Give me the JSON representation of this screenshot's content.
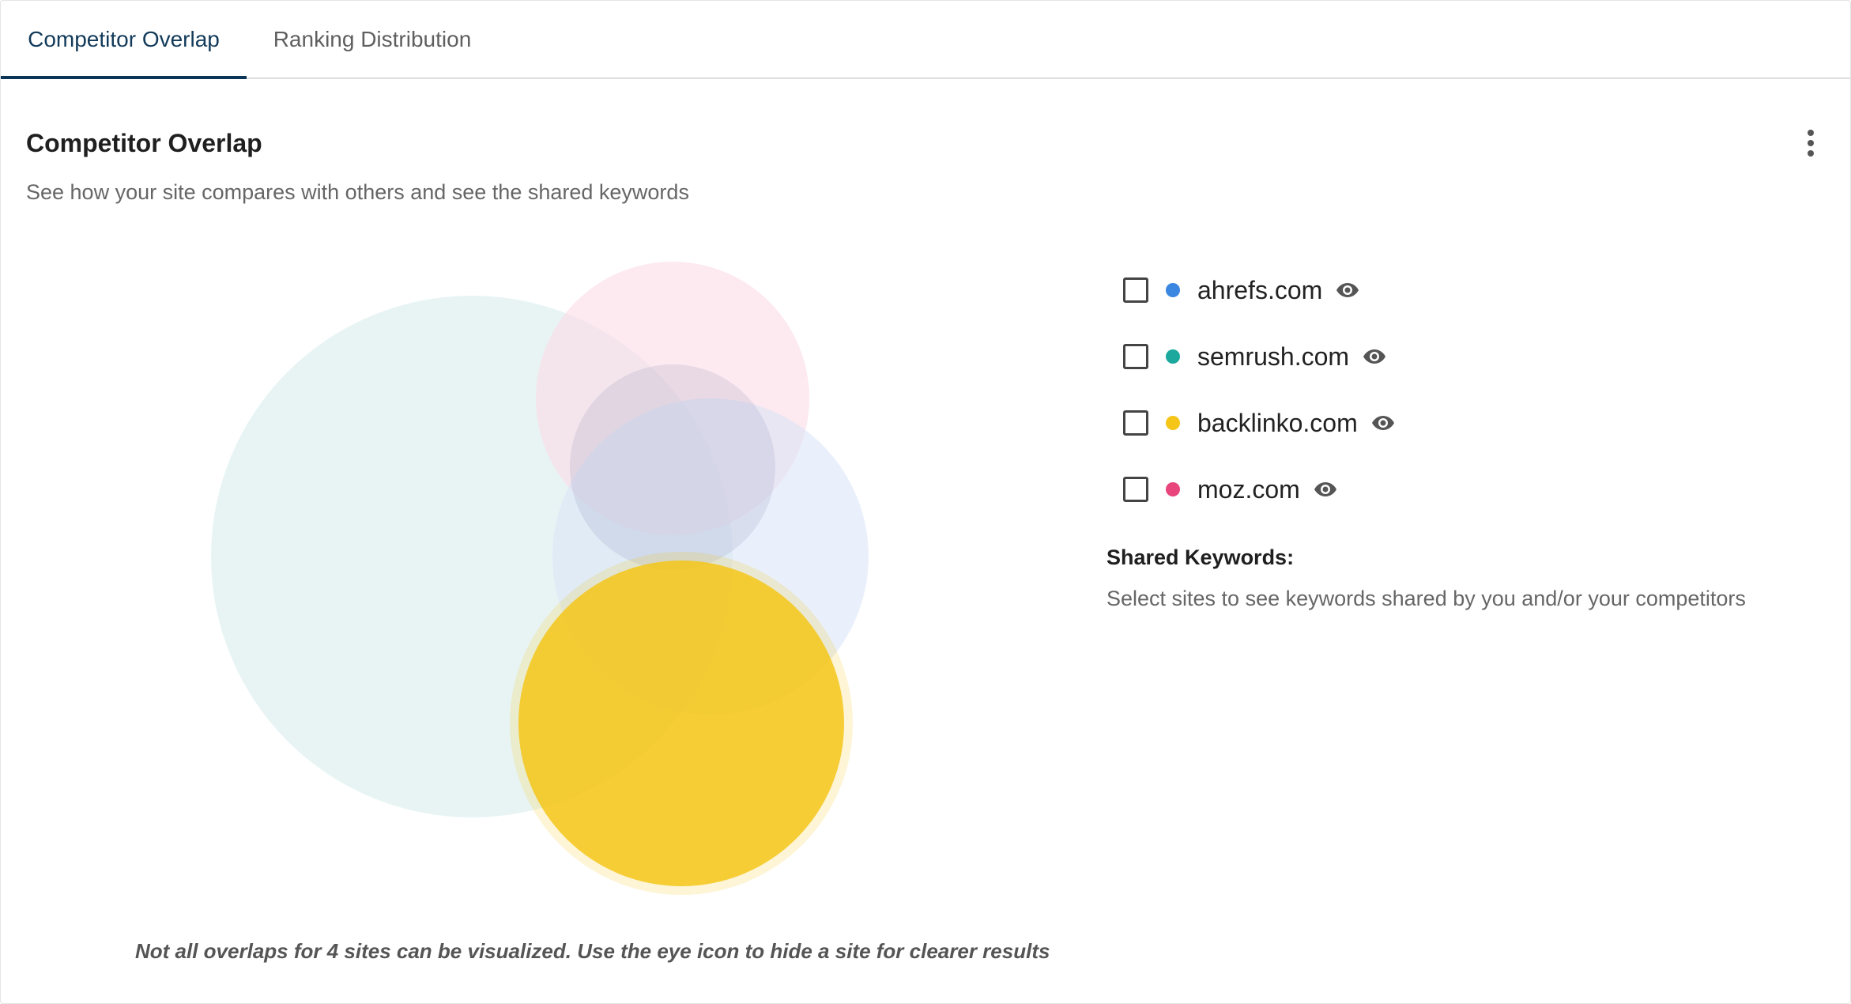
{
  "tabs": [
    {
      "label": "Competitor Overlap",
      "active": true
    },
    {
      "label": "Ranking Distribution",
      "active": false
    }
  ],
  "section": {
    "title": "Competitor Overlap",
    "description": "See how your site compares with others and see the shared keywords",
    "menu_icon": "more-vertical-icon"
  },
  "legend": {
    "items": [
      {
        "site": "ahrefs.com",
        "color": "#3b86e0",
        "checked": false,
        "icon": "eye-icon"
      },
      {
        "site": "semrush.com",
        "color": "#1ca89c",
        "checked": false,
        "icon": "eye-icon"
      },
      {
        "site": "backlinko.com",
        "color": "#f5c518",
        "checked": false,
        "icon": "eye-icon"
      },
      {
        "site": "moz.com",
        "color": "#e8457c",
        "checked": false,
        "icon": "eye-icon"
      }
    ]
  },
  "shared_keywords": {
    "title": "Shared Keywords:",
    "description": "Select sites to see keywords shared by you and/or your competitors"
  },
  "footnote": "Not all overlaps for 4 sites can be visualized. Use the eye icon to hide a site for clearer results",
  "colors": {
    "tab_active": "#0b3557",
    "teal_circle": "#e8f4f4",
    "pink_circle": "#fde7ef",
    "blue_circle": "#e5eefb",
    "yellow_circle": "#f5c518"
  }
}
